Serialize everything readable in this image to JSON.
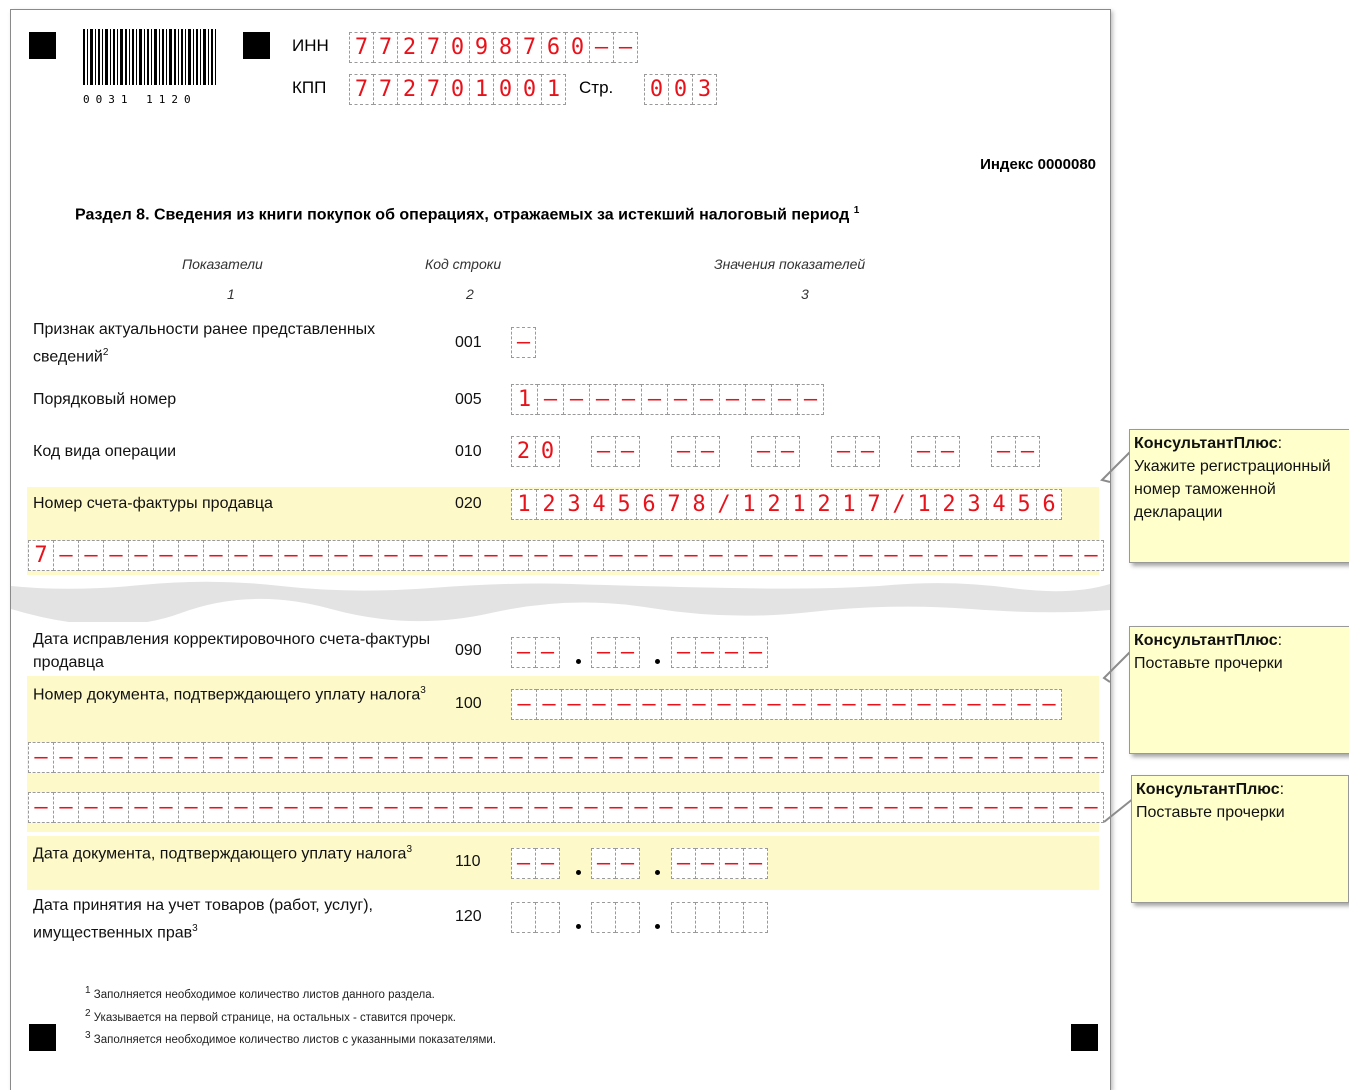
{
  "header": {
    "barcode_digits": "0031 1120",
    "inn_label": "ИНН",
    "inn_cells": [
      "7",
      "7",
      "2",
      "7",
      "0",
      "9",
      "8",
      "7",
      "6",
      "0",
      "-",
      "-"
    ],
    "kpp_label": "КПП",
    "kpp_cells": [
      "7",
      "7",
      "2",
      "7",
      "0",
      "1",
      "0",
      "0",
      "1"
    ],
    "page_label": "Стр.",
    "page_cells": [
      "0",
      "0",
      "3"
    ]
  },
  "index_label": "Индекс 0000080",
  "section_title": "Раздел 8. Сведения из книги покупок об операциях, отражаемых за истекший налоговый период",
  "section_title_sup": "1",
  "columns": {
    "c1": "Показатели",
    "c2": "Код строки",
    "c3": "Значения показателей",
    "n1": "1",
    "n2": "2",
    "n3": "3"
  },
  "rows": {
    "r001": {
      "label": "Признак актуальности ранее представленных сведений",
      "sup": "2",
      "code": "001",
      "cells": [
        "-"
      ]
    },
    "r005": {
      "label": "Порядковый номер",
      "code": "005",
      "cells": [
        "1",
        "-",
        "-",
        "-",
        "-",
        "-",
        "-",
        "-",
        "-",
        "-",
        "-",
        "-"
      ]
    },
    "r010": {
      "label": "Код вида операции",
      "code": "010",
      "groups": [
        [
          "2",
          "0"
        ],
        [
          "-",
          "-"
        ],
        [
          "-",
          "-"
        ],
        [
          "-",
          "-"
        ],
        [
          "-",
          "-"
        ],
        [
          "-",
          "-"
        ],
        [
          "-",
          "-"
        ]
      ]
    },
    "r020": {
      "label": "Номер счета-фактуры продавца",
      "code": "020",
      "cells": [
        "1",
        "2",
        "3",
        "4",
        "5",
        "6",
        "7",
        "8",
        "/",
        "1",
        "2",
        "1",
        "2",
        "1",
        "7",
        "/",
        "1",
        "2",
        "3",
        "4",
        "5",
        "6"
      ],
      "cells2": [
        "7",
        "-",
        "-",
        "-",
        "-",
        "-",
        "-",
        "-",
        "-",
        "-",
        "-",
        "-",
        "-",
        "-",
        "-",
        "-",
        "-",
        "-",
        "-",
        "-",
        "-",
        "-",
        "-",
        "-",
        "-",
        "-",
        "-",
        "-",
        "-",
        "-",
        "-",
        "-",
        "-",
        "-",
        "-",
        "-",
        "-",
        "-",
        "-",
        "-",
        "-",
        "-",
        "-"
      ]
    },
    "r090": {
      "label": "Дата исправления корректировочного счета-фактуры продавца",
      "code": "090",
      "d1": [
        "-",
        "-"
      ],
      "d2": [
        "-",
        "-"
      ],
      "d3": [
        "-",
        "-",
        "-",
        "-"
      ]
    },
    "r100": {
      "label": "Номер документа, подтверждающего уплату налога",
      "sup": "3",
      "code": "100",
      "cells": [
        "-",
        "-",
        "-",
        "-",
        "-",
        "-",
        "-",
        "-",
        "-",
        "-",
        "-",
        "-",
        "-",
        "-",
        "-",
        "-",
        "-",
        "-",
        "-",
        "-",
        "-",
        "-"
      ],
      "cells2": [
        "-",
        "-",
        "-",
        "-",
        "-",
        "-",
        "-",
        "-",
        "-",
        "-",
        "-",
        "-",
        "-",
        "-",
        "-",
        "-",
        "-",
        "-",
        "-",
        "-",
        "-",
        "-",
        "-",
        "-",
        "-",
        "-",
        "-",
        "-",
        "-",
        "-",
        "-",
        "-",
        "-",
        "-",
        "-",
        "-",
        "-",
        "-",
        "-",
        "-",
        "-",
        "-",
        "-"
      ],
      "cells3": [
        "-",
        "-",
        "-",
        "-",
        "-",
        "-",
        "-",
        "-",
        "-",
        "-",
        "-",
        "-",
        "-",
        "-",
        "-",
        "-",
        "-",
        "-",
        "-",
        "-",
        "-",
        "-",
        "-",
        "-",
        "-",
        "-",
        "-",
        "-",
        "-",
        "-",
        "-",
        "-",
        "-",
        "-",
        "-",
        "-",
        "-",
        "-",
        "-",
        "-",
        "-",
        "-",
        "-"
      ]
    },
    "r110": {
      "label": "Дата документа, подтверждающего уплату налога",
      "sup": "3",
      "code": "110",
      "d1": [
        "-",
        "-"
      ],
      "d2": [
        "-",
        "-"
      ],
      "d3": [
        "-",
        "-",
        "-",
        "-"
      ]
    },
    "r120": {
      "label": "Дата принятия на учет товаров (работ, услуг), имущественных прав",
      "sup": "3",
      "code": "120",
      "d1": [
        "",
        ""
      ],
      "d2": [
        "",
        ""
      ],
      "d3": [
        "",
        "",
        "",
        ""
      ]
    }
  },
  "footnotes": [
    {
      "sup": "1",
      "text": "Заполняется необходимое количество листов данного раздела."
    },
    {
      "sup": "2",
      "text": "Указывается на первой странице, на остальных - ставится прочерк."
    },
    {
      "sup": "3",
      "text": "Заполняется необходимое количество листов с указанными показателями."
    }
  ],
  "notes": [
    {
      "title": "КонсультантПлюс",
      "text": "Укажите регистрационный номер таможенной декларации"
    },
    {
      "title": "КонсультантПлюс",
      "text": "Поставьте прочерки"
    },
    {
      "title": "КонсультантПлюс",
      "text": "Поставьте прочерки"
    }
  ],
  "colors": {
    "highlight": "#fdf9c9",
    "digit": "#e8121b",
    "note_bg": "#ffffcc"
  }
}
